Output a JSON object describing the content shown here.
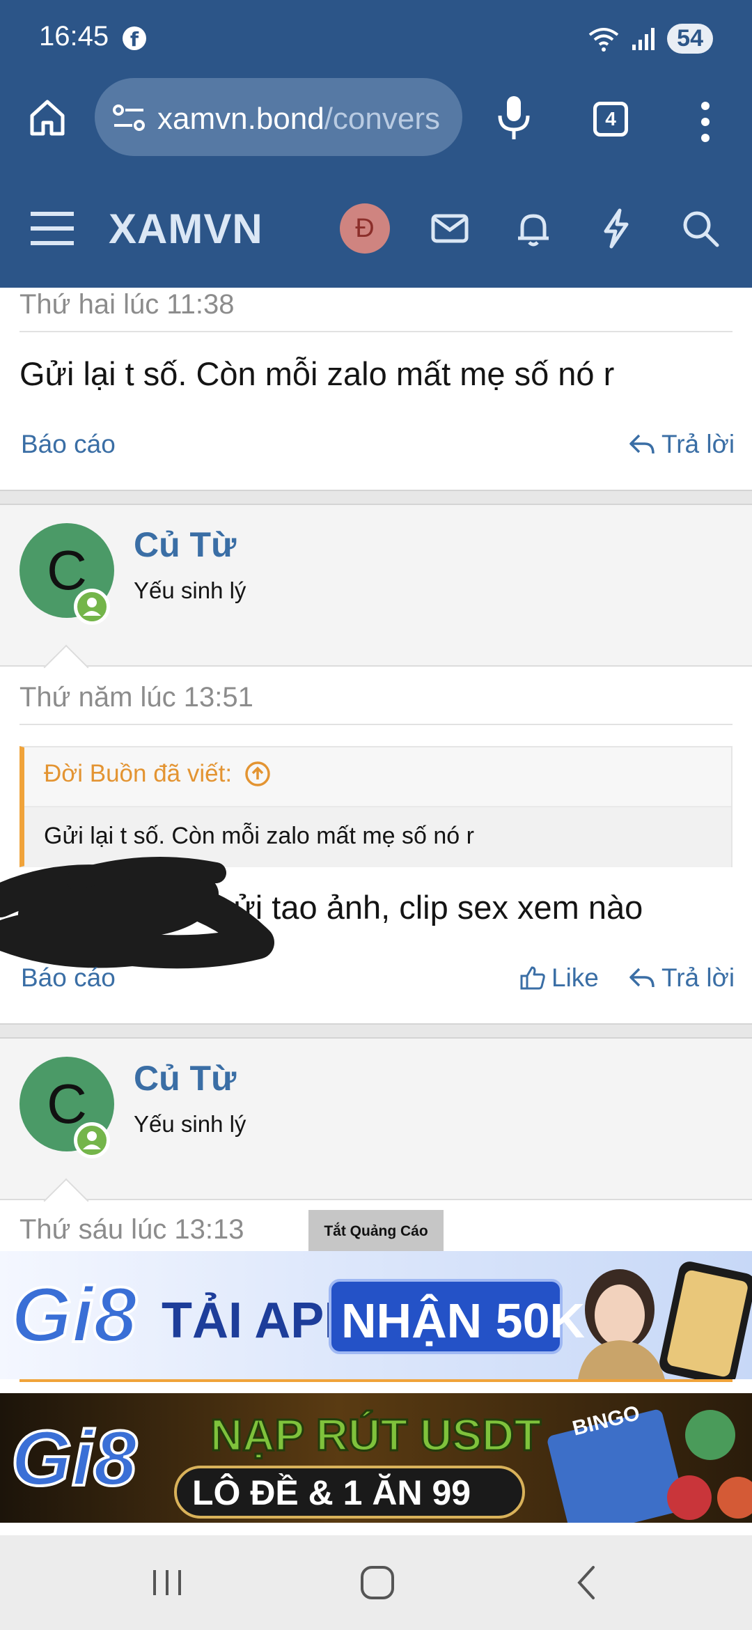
{
  "status_bar": {
    "time": "16:45",
    "battery": "54",
    "notification_icon": "facebook-icon"
  },
  "browser": {
    "url_host": "xamvn.bond",
    "url_path": "/convers",
    "tab_count": "4"
  },
  "forum_nav": {
    "site_title": "XAMVN",
    "avatar_initial": "Đ"
  },
  "messages": [
    {
      "date": "Thứ hai lúc 11:38",
      "text": "Gửi lại t số. Còn mỗi zalo mất mẹ số nó r",
      "report": "Báo cáo",
      "reply": "Trả lời"
    },
    {
      "user": {
        "initial": "C",
        "name": "Củ Từ",
        "title": "Yếu sinh lý"
      },
      "date": "Thứ năm lúc 13:51",
      "quote": {
        "author_line": "Đời Buồn đã viết:",
        "text": "Gửi lại t số. Còn mỗi zalo mất mẹ số nó r"
      },
      "text": "o gửi tao ảnh, clip sex xem nào",
      "report": "Báo cáo",
      "like": "Like",
      "reply": "Trả lời"
    },
    {
      "user": {
        "initial": "C",
        "name": "Củ Từ",
        "title": "Yếu sinh lý"
      },
      "date": "Thứ sáu lúc 13:13"
    }
  ],
  "ads": {
    "close_label": "Tắt Quảng Cáo",
    "banner1": {
      "brand": "Gi8",
      "headline": "TẢI APP",
      "badge": "NHẬN 50K"
    },
    "banner2": {
      "brand": "Gi8",
      "headline": "NẠP RÚT USDT",
      "subline": "LÔ ĐỀ & 1 ĂN 99",
      "tag": "BINGO"
    }
  },
  "colors": {
    "header": "#2c5588",
    "link": "#3a6ea5",
    "quote_accent": "#f0a33a",
    "avatar": "#4b9a67",
    "online": "#74b54a"
  }
}
